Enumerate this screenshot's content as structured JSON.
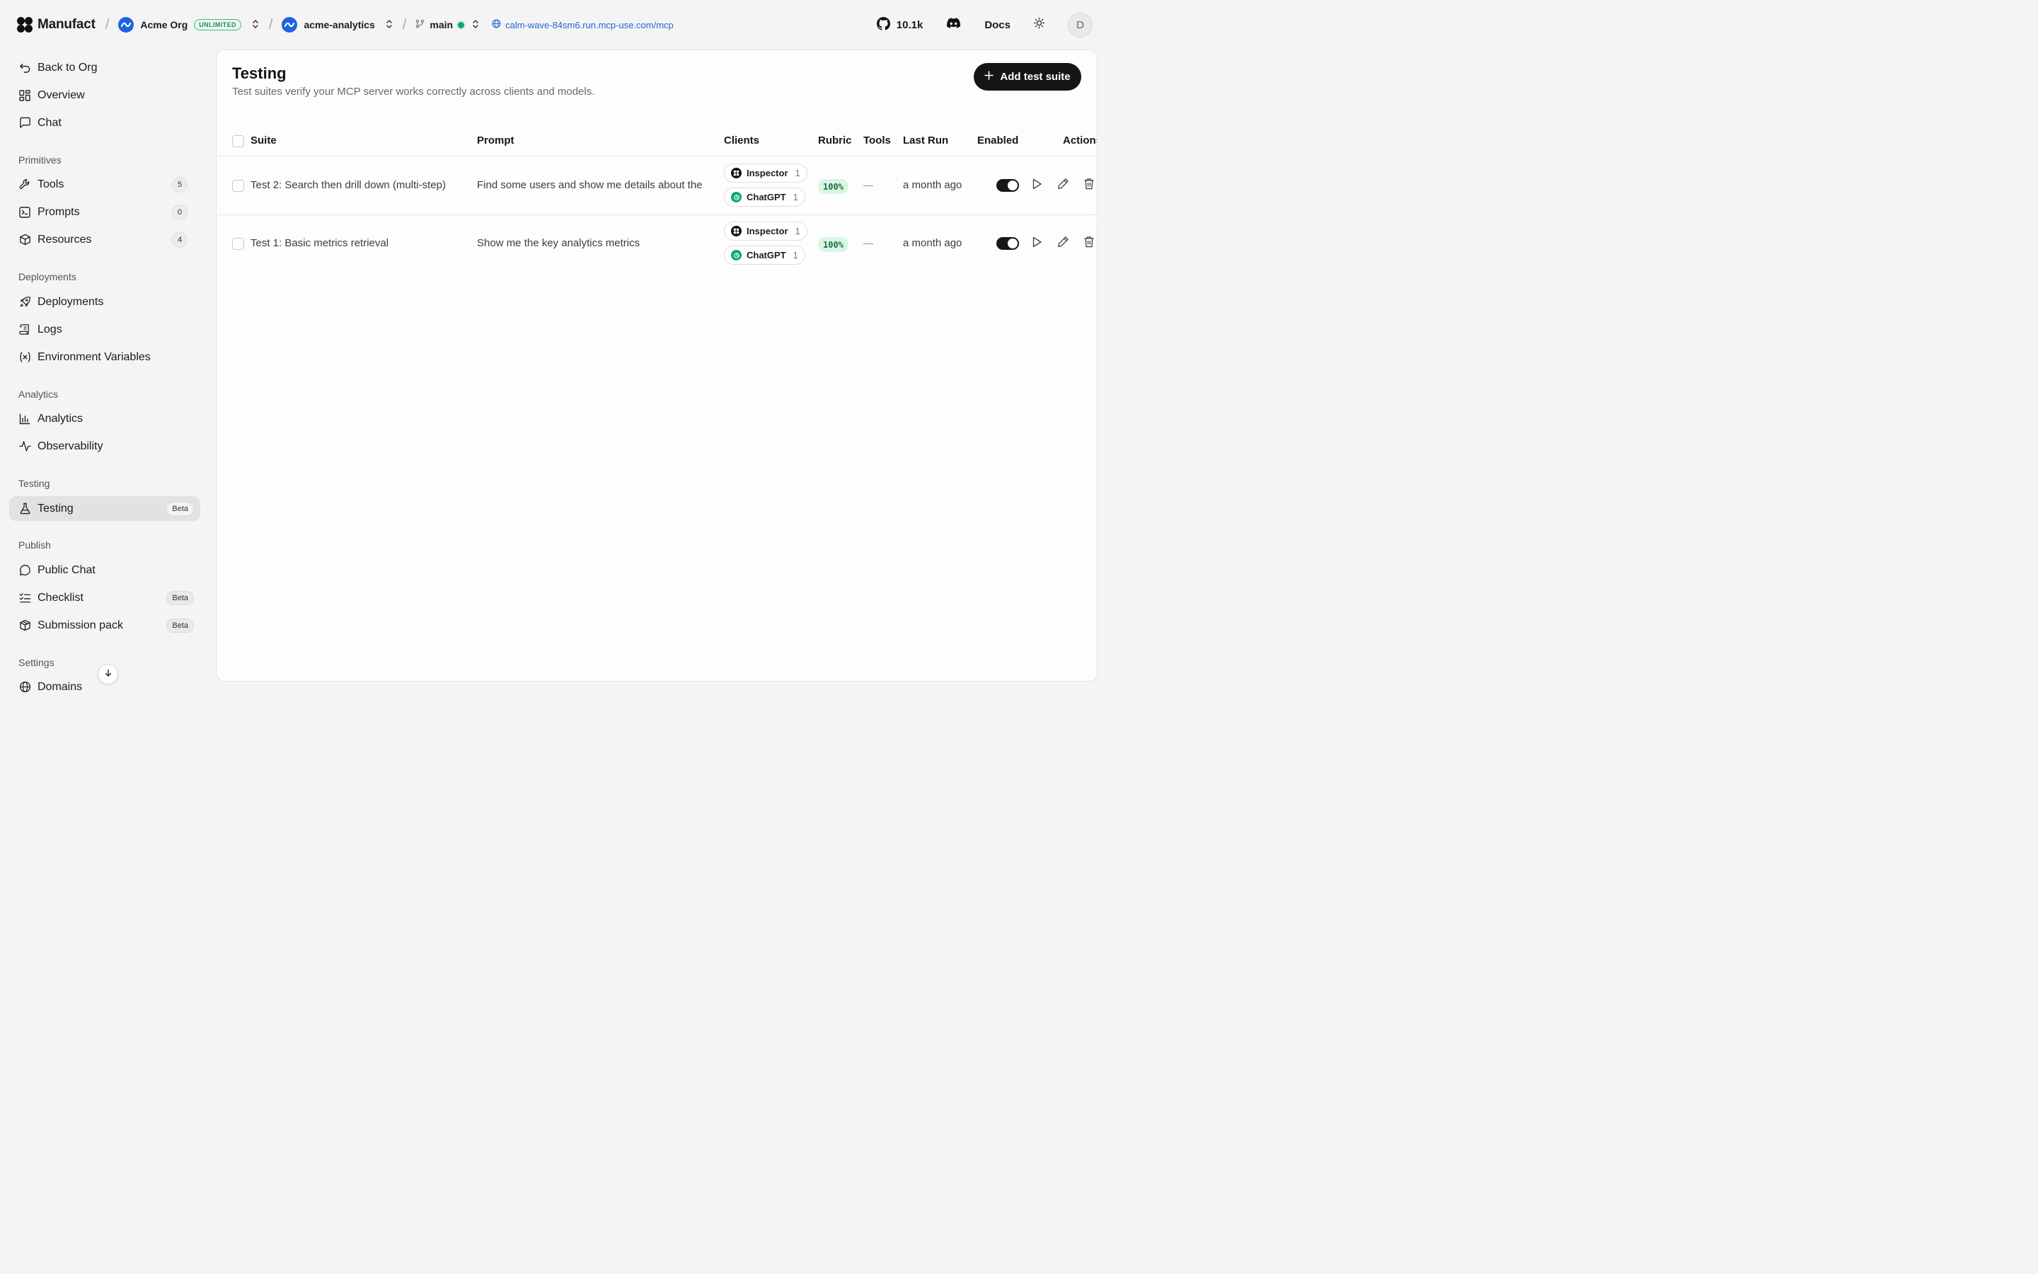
{
  "topbar": {
    "brand": "Manufact",
    "org": {
      "name": "Acme Org",
      "plan": "UNLIMITED"
    },
    "project": "acme-analytics",
    "branch": "main",
    "url": "calm-wave-84sm6.run.mcp-use.com/mcp",
    "github_stars": "10.1k",
    "docs_label": "Docs",
    "avatar_initial": "D",
    "separator": "/"
  },
  "sidebar": {
    "top": [
      {
        "label": "Back to Org",
        "icon": "undo-icon"
      },
      {
        "label": "Overview",
        "icon": "layout-grid-icon"
      },
      {
        "label": "Chat",
        "icon": "message-square-icon"
      }
    ],
    "sections": {
      "primitives": "Primitives",
      "deployments": "Deployments",
      "analytics": "Analytics",
      "testing": "Testing",
      "publish": "Publish",
      "settings": "Settings"
    },
    "primitives": [
      {
        "label": "Tools",
        "count": "5",
        "icon": "wrench-icon"
      },
      {
        "label": "Prompts",
        "count": "0",
        "icon": "terminal-square-icon"
      },
      {
        "label": "Resources",
        "count": "4",
        "icon": "box-icon"
      }
    ],
    "deployments": [
      {
        "label": "Deployments",
        "icon": "rocket-icon"
      },
      {
        "label": "Logs",
        "icon": "scroll-icon"
      },
      {
        "label": "Environment Variables",
        "icon": "variable-icon"
      }
    ],
    "analytics": [
      {
        "label": "Analytics",
        "icon": "bar-chart-icon"
      },
      {
        "label": "Observability",
        "icon": "activity-icon"
      }
    ],
    "testing": [
      {
        "label": "Testing",
        "badge": "Beta",
        "icon": "flask-icon"
      }
    ],
    "publish": [
      {
        "label": "Public Chat",
        "icon": "message-circle-icon"
      },
      {
        "label": "Checklist",
        "badge": "Beta",
        "icon": "list-checks-icon"
      },
      {
        "label": "Submission pack",
        "badge": "Beta",
        "icon": "package-icon"
      }
    ],
    "settings": [
      {
        "label": "Domains",
        "icon": "globe-icon"
      }
    ]
  },
  "main": {
    "title": "Testing",
    "subtitle": "Test suites verify your MCP server works correctly across clients and models.",
    "add_button": "Add test suite",
    "columns": [
      "Suite",
      "Prompt",
      "Clients",
      "Rubric",
      "Tools",
      "Last Run",
      "Enabled",
      "Actions"
    ],
    "rows": [
      {
        "suite": "Test 2: Search then drill down (multi-step)",
        "prompt": "Find some users and show me details about the",
        "clients": [
          {
            "name": "Inspector",
            "count": "1"
          },
          {
            "name": "ChatGPT",
            "count": "1"
          }
        ],
        "rubric": "100%",
        "tools": "—",
        "last_run": "a month ago",
        "enabled": true
      },
      {
        "suite": "Test 1: Basic metrics retrieval",
        "prompt": "Show me the key analytics metrics",
        "clients": [
          {
            "name": "Inspector",
            "count": "1"
          },
          {
            "name": "ChatGPT",
            "count": "1"
          }
        ],
        "rubric": "100%",
        "tools": "—",
        "last_run": "a month ago",
        "enabled": true
      }
    ]
  },
  "colors": {
    "accent_blue": "#1f63e0",
    "link_blue": "#2563d6",
    "status_green": "#16a36a",
    "rubric_bg": "#d9f6e3",
    "button_dark": "#151515"
  }
}
